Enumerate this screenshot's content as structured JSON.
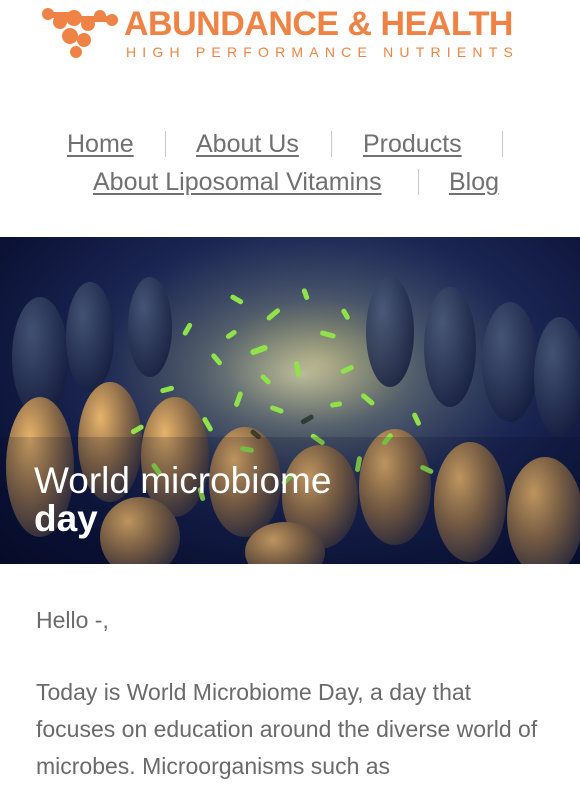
{
  "brand": {
    "name": "ABUNDANCE & HEALTH",
    "tagline": "HIGH PERFORMANCE NUTRIENTS",
    "logo_icon": "molecule-logo-icon",
    "color": "#ef8345"
  },
  "nav": {
    "items": [
      {
        "label": "Home"
      },
      {
        "label": "About Us"
      },
      {
        "label": "Products"
      },
      {
        "label": "About Liposomal Vitamins"
      },
      {
        "label": "Blog"
      }
    ]
  },
  "hero": {
    "title_line1": "World microbiome",
    "title_line2": "day",
    "image": "microbiome-illustration"
  },
  "content": {
    "greeting": "Hello -,",
    "paragraph": "Today is World Microbiome Day, a day that focuses on education around the diverse world of microbes. Microorganisms such as"
  },
  "colors": {
    "text": "#6a6a6a",
    "nav_text": "#707070",
    "hero_bg": "#0b1236"
  }
}
